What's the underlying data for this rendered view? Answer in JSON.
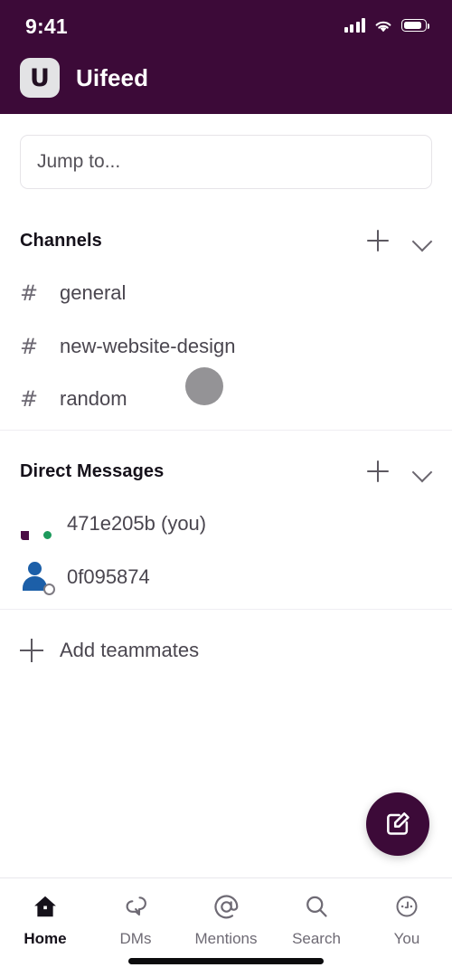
{
  "status_bar": {
    "time": "9:41",
    "signal_icon": "signal-bars-icon",
    "wifi_icon": "wifi-icon",
    "battery_icon": "battery-icon"
  },
  "header": {
    "logo_letter": "U",
    "workspace_name": "Uifeed",
    "background_color": "#3c0a38"
  },
  "search": {
    "placeholder": "Jump to...",
    "value": ""
  },
  "channels_section": {
    "title": "Channels",
    "add_icon": "plus-icon",
    "collapse_icon": "chevron-down-icon",
    "items": [
      {
        "prefix": "#",
        "label": "general"
      },
      {
        "prefix": "#",
        "label": "new-website-design"
      },
      {
        "prefix": "#",
        "label": "random"
      }
    ]
  },
  "direct_messages_section": {
    "title": "Direct Messages",
    "add_icon": "plus-icon",
    "collapse_icon": "chevron-down-icon",
    "items": [
      {
        "label": "471e205b (you)",
        "avatar": "purple-person-avatar",
        "presence": "online",
        "presence_color": "#1d9a5c"
      },
      {
        "label": "0f095874",
        "avatar": "blue-person-avatar",
        "presence": "offline",
        "presence_color": "#ffffff"
      }
    ]
  },
  "add_teammates": {
    "label": "Add teammates",
    "icon": "plus-icon"
  },
  "compose_fab": {
    "icon": "compose-pencil-icon",
    "color": "#3c0a38"
  },
  "touch_indicator": {
    "visible": true,
    "color": "#949396"
  },
  "bottom_nav": {
    "tabs": [
      {
        "label": "Home",
        "icon": "home-icon",
        "active": true
      },
      {
        "label": "DMs",
        "icon": "chat-bubbles-icon",
        "active": false
      },
      {
        "label": "Mentions",
        "icon": "at-sign-icon",
        "active": false
      },
      {
        "label": "Search",
        "icon": "search-icon",
        "active": false
      },
      {
        "label": "You",
        "icon": "profile-face-icon",
        "active": false
      }
    ]
  },
  "home_indicator": {
    "visible": true
  }
}
